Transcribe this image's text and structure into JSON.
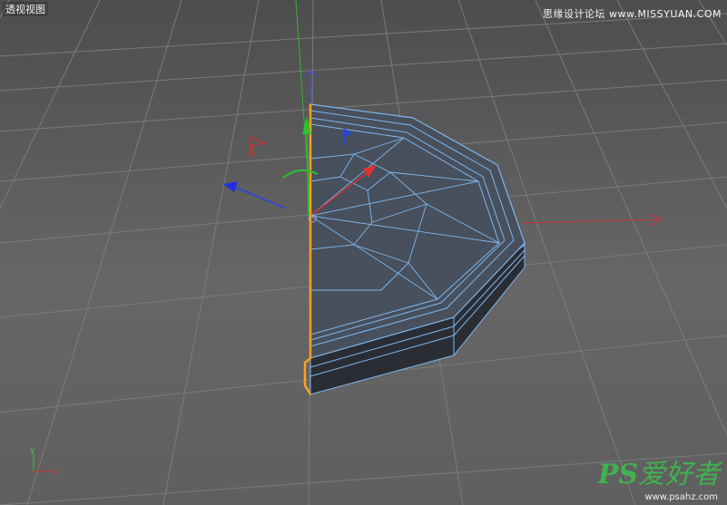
{
  "viewport": {
    "label": "透视视图",
    "mini_axes": {
      "y": "y",
      "x": "x"
    }
  },
  "watermark": {
    "site_text": "思缘设计论坛 www.MISSYUAN.COM",
    "logo_ps": "PS",
    "logo_cn": "爱好者",
    "logo_url": "www.psahz.com"
  },
  "colors": {
    "background": "#5b5b5b",
    "grid": "#7a7a7a",
    "mesh_fill": "#3f4550",
    "mesh_edge": "#7fb6ef",
    "selection_edge": "#ffa020",
    "axis_x": "#e03030",
    "axis_y": "#30c030",
    "axis_z": "#3040e0"
  }
}
